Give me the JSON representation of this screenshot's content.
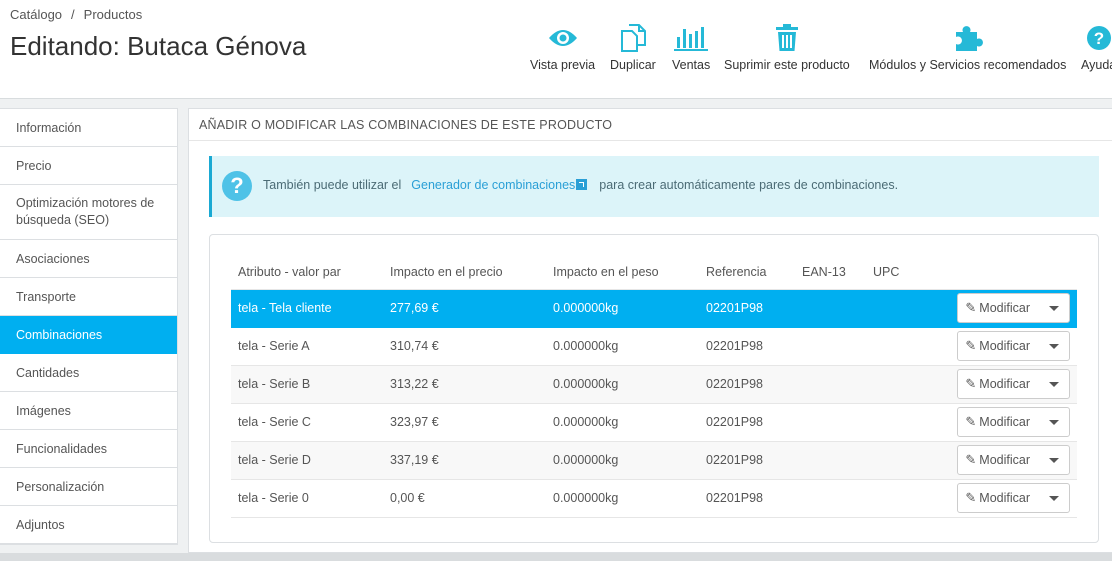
{
  "breadcrumb": {
    "parent": "Catálogo",
    "separator": "/",
    "current": "Productos"
  },
  "page_title": "Editando: Butaca Génova",
  "toolbar": {
    "preview": "Vista previa",
    "duplicate": "Duplicar",
    "sales": "Ventas",
    "delete": "Suprimir este producto",
    "modules": "Módulos y Servicios recomendados",
    "help": "Ayuda"
  },
  "sidebar": {
    "items": [
      {
        "label": "Información"
      },
      {
        "label": "Precio"
      },
      {
        "label": "Optimización motores de búsqueda (SEO)"
      },
      {
        "label": "Asociaciones"
      },
      {
        "label": "Transporte"
      },
      {
        "label": "Combinaciones"
      },
      {
        "label": "Cantidades"
      },
      {
        "label": "Imágenes"
      },
      {
        "label": "Funcionalidades"
      },
      {
        "label": "Personalización"
      },
      {
        "label": "Adjuntos"
      }
    ],
    "active": "Combinaciones"
  },
  "panel": {
    "heading": "AÑADIR O MODIFICAR LAS COMBINACIONES DE ESTE PRODUCTO",
    "alert": {
      "before": "También puede utilizar el",
      "link": "Generador de combinaciones",
      "after": "para crear automáticamente pares de combinaciones."
    }
  },
  "table": {
    "headers": {
      "attribute": "Atributo - valor par",
      "price_impact": "Impacto en el precio",
      "weight_impact": "Impacto en el peso",
      "reference": "Referencia",
      "ean": "EAN-13",
      "upc": "UPC"
    },
    "rows": [
      {
        "attribute": "tela - Tela cliente",
        "price": "277,69 €",
        "weight": "0.000000kg",
        "reference": "02201P98",
        "ean": "",
        "upc": ""
      },
      {
        "attribute": "tela - Serie A",
        "price": "310,74 €",
        "weight": "0.000000kg",
        "reference": "02201P98",
        "ean": "",
        "upc": ""
      },
      {
        "attribute": "tela - Serie B",
        "price": "313,22 €",
        "weight": "0.000000kg",
        "reference": "02201P98",
        "ean": "",
        "upc": ""
      },
      {
        "attribute": "tela - Serie C",
        "price": "323,97 €",
        "weight": "0.000000kg",
        "reference": "02201P98",
        "ean": "",
        "upc": ""
      },
      {
        "attribute": "tela - Serie D",
        "price": "337,19 €",
        "weight": "0.000000kg",
        "reference": "02201P98",
        "ean": "",
        "upc": ""
      },
      {
        "attribute": "tela - Serie 0",
        "price": "0,00 €",
        "weight": "0.000000kg",
        "reference": "02201P98",
        "ean": "",
        "upc": ""
      }
    ],
    "edit_label": "Modificar"
  },
  "icons": {
    "preview": "eye-icon",
    "duplicate": "copy-icon",
    "sales": "bar-chart-icon",
    "delete": "trash-icon",
    "modules": "puzzle-icon",
    "help": "question-icon",
    "edit": "pencil-icon"
  },
  "colors": {
    "accent": "#00aff0",
    "toolbar_icon": "#25b9d7",
    "alert_bg": "#dcf4f9"
  }
}
